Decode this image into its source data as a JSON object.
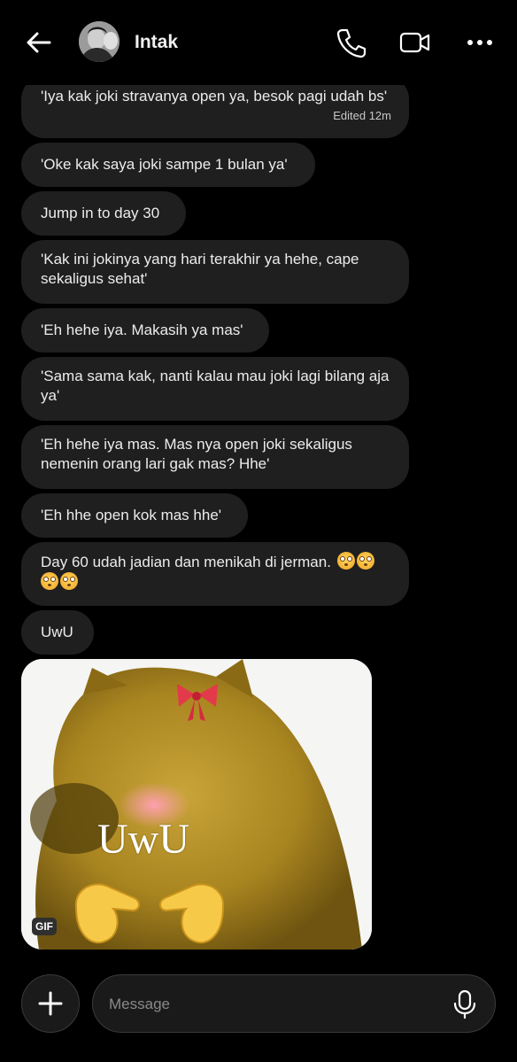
{
  "header": {
    "contact_name": "Intak",
    "icons": {
      "back": "arrow-left-icon",
      "call": "phone-icon",
      "video": "video-camera-icon",
      "more": "more-horizontal-icon"
    }
  },
  "messages": [
    {
      "text": "'Iya kak joki stravanya open ya, besok pagi udah bs'",
      "edited": "Edited 12m"
    },
    {
      "text": "'Oke kak saya joki sampe 1 bulan ya'"
    },
    {
      "text": "Jump in to day 30"
    },
    {
      "text": "'Kak ini jokinya yang hari terakhir ya hehe, cape sekaligus sehat'"
    },
    {
      "text": "'Eh hehe iya. Makasih ya mas'"
    },
    {
      "text": "'Sama sama kak, nanti kalau mau joki lagi bilang aja ya'"
    },
    {
      "text": "'Eh hehe iya mas. Mas nya open joki sekaligus nemenin orang lari gak mas? Hhe'"
    },
    {
      "text": "'Eh hhe open kok mas hhe'"
    },
    {
      "text": "Day 60 udah jadian dan menikah di jerman."
    },
    {
      "text": "UwU"
    }
  ],
  "gif": {
    "badge": "GIF",
    "caption": "UwU"
  },
  "composer": {
    "placeholder": "Message",
    "icons": {
      "add": "plus-icon",
      "mic": "microphone-icon"
    }
  },
  "colors": {
    "background": "#000000",
    "bubble": "#1f1f1f",
    "text": "#ececec"
  }
}
